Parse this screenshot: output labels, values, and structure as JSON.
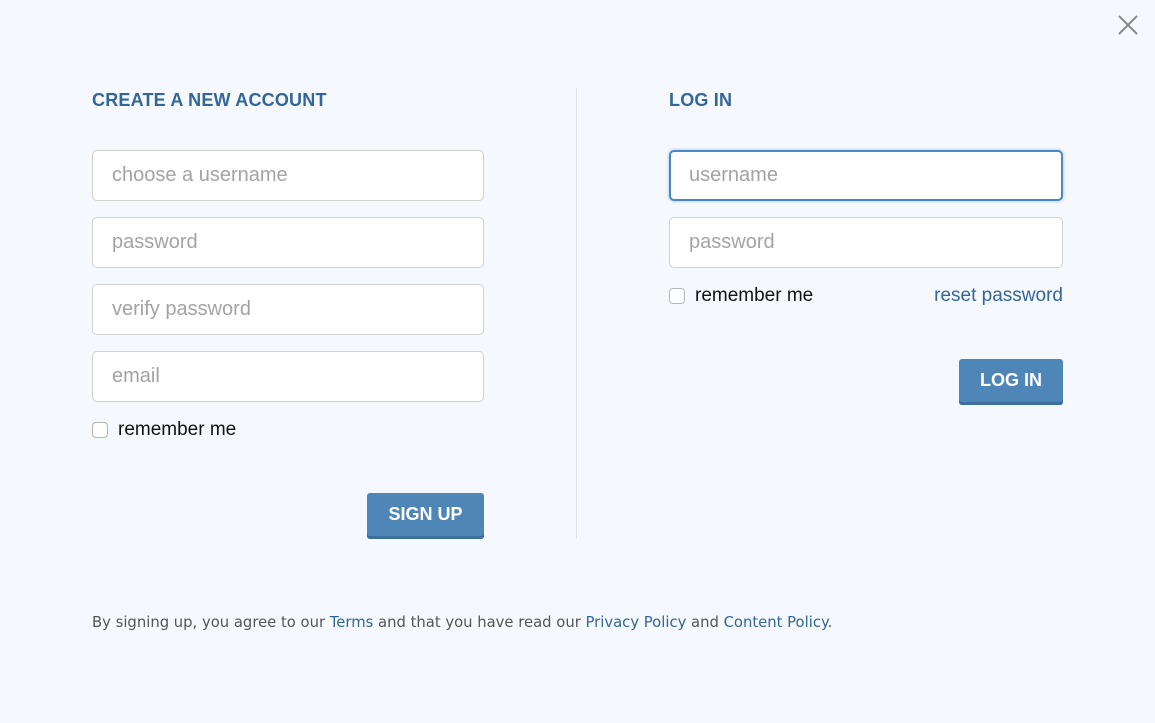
{
  "close": {
    "icon": "close-icon"
  },
  "signup": {
    "title": "CREATE A NEW ACCOUNT",
    "username_placeholder": "choose a username",
    "password_placeholder": "password",
    "verify_placeholder": "verify password",
    "email_placeholder": "email",
    "remember_label": "remember me",
    "remember_checked": false,
    "button_label": "SIGN UP"
  },
  "login": {
    "title": "LOG IN",
    "username_placeholder": "username",
    "password_placeholder": "password",
    "remember_label": "remember me",
    "remember_checked": false,
    "reset_label": "reset password",
    "button_label": "LOG IN"
  },
  "footer": {
    "prefix": "By signing up, you agree to our ",
    "terms": "Terms",
    "middle": " and that you have read our ",
    "privacy": "Privacy Policy",
    "and": " and ",
    "content": "Content Policy",
    "suffix": "."
  },
  "colors": {
    "accent": "#336699",
    "button": "#4f86b8",
    "focus": "#4a86c8",
    "background": "#f5f9fd"
  }
}
